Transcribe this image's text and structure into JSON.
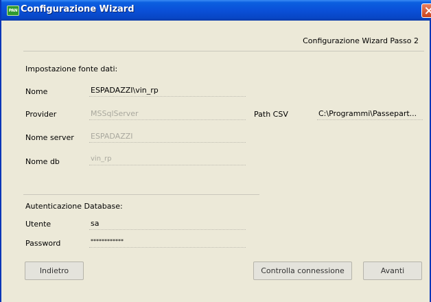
{
  "window": {
    "title": "Configurazione Wizard",
    "app_icon_text": "PAN"
  },
  "header": {
    "step_label": "Configurazione Wizard Passo 2"
  },
  "datasource": {
    "section_title": "Impostazione fonte dati:",
    "nome": {
      "label": "Nome",
      "value": "ESPADAZZI\\vin_rp"
    },
    "provider": {
      "label": "Provider",
      "value": "MSSqlServer"
    },
    "nome_server": {
      "label": "Nome server",
      "value": "ESPADAZZI"
    },
    "nome_db": {
      "label": "Nome db",
      "value": "vin_rp"
    },
    "path_csv": {
      "label": "Path CSV",
      "value": "C:\\Programmi\\Passepart..."
    }
  },
  "auth": {
    "section_title": "Autenticazione Database:",
    "utente": {
      "label": "Utente",
      "value": "sa"
    },
    "password": {
      "label": "Password",
      "value": "************"
    }
  },
  "buttons": {
    "back": "Indietro",
    "check": "Controlla connessione",
    "next": "Avanti"
  }
}
